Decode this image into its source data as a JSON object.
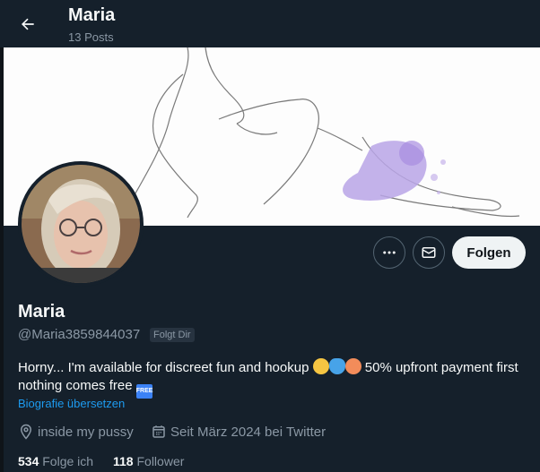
{
  "header": {
    "title": "Maria",
    "posts_count": "13 Posts"
  },
  "actions": {
    "follow_label": "Folgen"
  },
  "profile": {
    "name": "Maria",
    "handle": "@Maria3859844037",
    "follows_you_badge": "Folgt Dir",
    "bio_text_1": "Horny... I'm available for discreet fun and hookup ",
    "bio_text_2": " 50% upfront payment first nothing comes free ",
    "bio_free_icon_text": "FREE",
    "translate_link": "Biografie übersetzen",
    "location": "inside my pussy",
    "joined": "Seit März 2024 bei Twitter"
  },
  "stats": {
    "following_count": "534",
    "following_label": "Folge ich",
    "followers_count": "118",
    "followers_label": "Follower"
  },
  "colors": {
    "background": "#15202b",
    "accent": "#1d9bf0",
    "muted": "#8b98a5"
  },
  "icons": [
    "back-arrow-icon",
    "more-icon",
    "mail-icon",
    "location-icon",
    "calendar-icon"
  ]
}
